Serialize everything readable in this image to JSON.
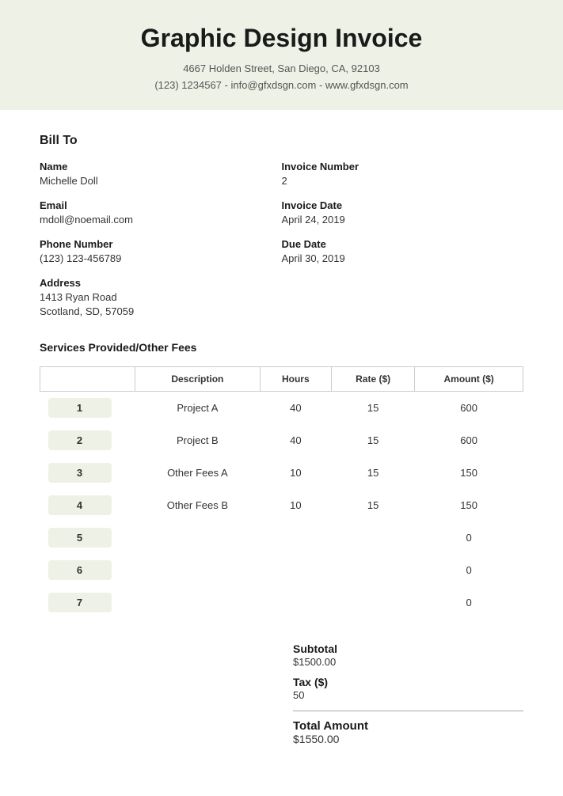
{
  "header": {
    "title": "Graphic Design Invoice",
    "address": "4667 Holden Street, San Diego, CA, 92103",
    "contact": "(123) 1234567 - info@gfxdsgn.com - www.gfxdsgn.com"
  },
  "bill_to": {
    "heading": "Bill To",
    "fields": [
      {
        "label": "Name",
        "value": "Michelle Doll"
      },
      {
        "label": "Invoice Number",
        "value": "2"
      },
      {
        "label": "Email",
        "value": "mdoll@noemail.com"
      },
      {
        "label": "Invoice Date",
        "value": "April 24, 2019"
      },
      {
        "label": "Phone Number",
        "value": "(123) 123-456789"
      },
      {
        "label": "Due Date",
        "value": "April 30, 2019"
      },
      {
        "label": "Address",
        "value": "1413 Ryan Road\nScotland, SD, 57059"
      }
    ]
  },
  "services": {
    "heading": "Services Provided/Other Fees",
    "columns": [
      "Description",
      "Hours",
      "Rate ($)",
      "Amount ($)"
    ],
    "rows": [
      {
        "num": "1",
        "description": "Project A",
        "hours": "40",
        "rate": "15",
        "amount": "600"
      },
      {
        "num": "2",
        "description": "Project B",
        "hours": "40",
        "rate": "15",
        "amount": "600"
      },
      {
        "num": "3",
        "description": "Other Fees A",
        "hours": "10",
        "rate": "15",
        "amount": "150"
      },
      {
        "num": "4",
        "description": "Other Fees B",
        "hours": "10",
        "rate": "15",
        "amount": "150"
      },
      {
        "num": "5",
        "description": "",
        "hours": "",
        "rate": "",
        "amount": "0"
      },
      {
        "num": "6",
        "description": "",
        "hours": "",
        "rate": "",
        "amount": "0"
      },
      {
        "num": "7",
        "description": "",
        "hours": "",
        "rate": "",
        "amount": "0"
      }
    ]
  },
  "totals": {
    "subtotal_label": "Subtotal",
    "subtotal_value": "$1500.00",
    "tax_label": "Tax ($)",
    "tax_value": "50",
    "total_label": "Total Amount",
    "total_value": "$1550.00"
  }
}
